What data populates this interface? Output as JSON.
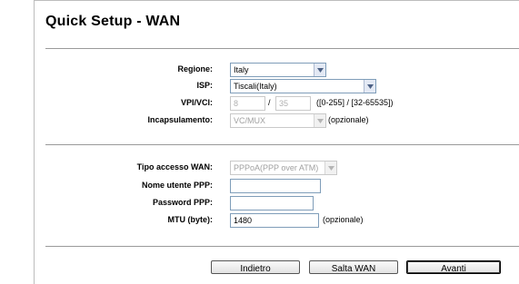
{
  "page": {
    "title": "Quick Setup - WAN"
  },
  "section1": {
    "regione": {
      "label": "Regione:",
      "value": "Italy"
    },
    "isp": {
      "label": "ISP:",
      "value": "Tiscali(Italy)"
    },
    "vpivci": {
      "label": "VPI/VCI:",
      "vpi": "8",
      "separator": "/",
      "vci": "35",
      "range": "([0-255] / [32-65535])"
    },
    "incapsulamento": {
      "label": "Incapsulamento:",
      "value": "VC/MUX",
      "note": "(opzionale)"
    }
  },
  "section2": {
    "tipo_accesso": {
      "label": "Tipo accesso WAN:",
      "value": "PPPoA(PPP over ATM)"
    },
    "nome_utente": {
      "label": "Nome utente PPP:",
      "value": ""
    },
    "password": {
      "label": "Password PPP:",
      "value": ""
    },
    "mtu": {
      "label": "MTU (byte):",
      "value": "1480",
      "note": "(opzionale)"
    }
  },
  "buttons": {
    "back": "Indietro",
    "skip": "Salta WAN",
    "next": "Avanti"
  }
}
